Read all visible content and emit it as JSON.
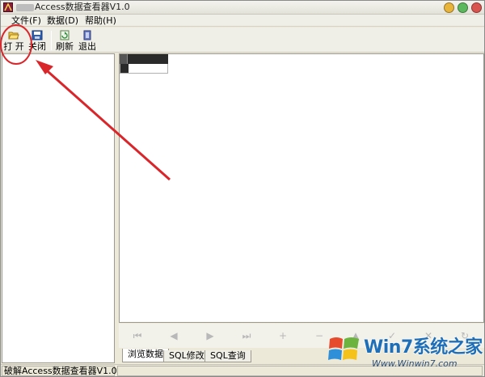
{
  "window": {
    "title": "Access数据查看器V1.0",
    "controls": {
      "minimize_color": "#e8b43a",
      "maximize_color": "#5cb85c",
      "close_color": "#d9534f"
    }
  },
  "menu": {
    "items": [
      {
        "label": "文件(F)"
      },
      {
        "label": "数据(D)"
      },
      {
        "label": "帮助(H)"
      }
    ]
  },
  "toolbar": {
    "open_label": "打 开",
    "close_label": "关闭",
    "refresh_label": "刷新",
    "exit_label": "退出",
    "icons": {
      "open": "folder-open-icon",
      "close": "save-close-icon",
      "refresh": "refresh-icon",
      "exit": "exit-door-icon"
    }
  },
  "navigator": {
    "buttons": [
      {
        "name": "first",
        "glyph": "⏮"
      },
      {
        "name": "prior",
        "glyph": "◀"
      },
      {
        "name": "next",
        "glyph": "▶"
      },
      {
        "name": "last",
        "glyph": "⏭"
      },
      {
        "name": "insert",
        "glyph": "+"
      },
      {
        "name": "delete",
        "glyph": "−"
      },
      {
        "name": "edit",
        "glyph": "▲"
      },
      {
        "name": "post",
        "glyph": "✓"
      },
      {
        "name": "cancel",
        "glyph": "✕"
      },
      {
        "name": "refresh",
        "glyph": "↻"
      }
    ]
  },
  "tabs": [
    {
      "label": "浏览数据",
      "active": true
    },
    {
      "label": "SQL修改",
      "active": false
    },
    {
      "label": "SQL查询",
      "active": false
    }
  ],
  "statusbar": {
    "text": "破解Access数据查看器V1.0"
  },
  "watermark": {
    "main": "Win7系统之家",
    "sub": "Www.Winwin7.com"
  },
  "colors": {
    "annotation_red": "#d9262b",
    "accent_blue": "#1e6fb8"
  }
}
